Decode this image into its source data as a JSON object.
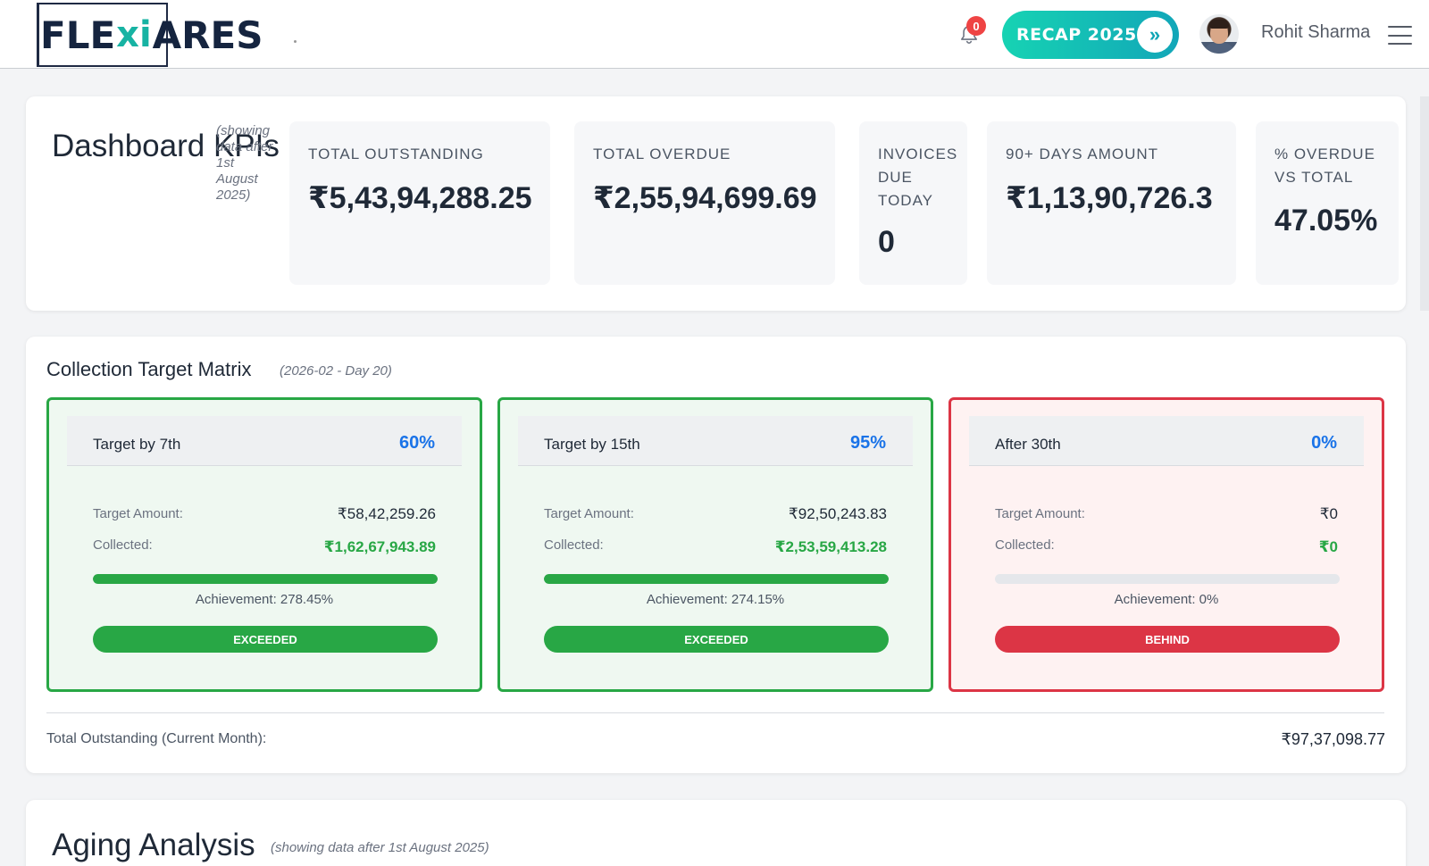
{
  "header": {
    "logo_left": "FLE",
    "logo_x": "xi",
    "logo_right": "ARES",
    "notification_count": "0",
    "recap_label": "RECAP 2025",
    "recap_arrow": "»",
    "user_name": "Rohit Sharma"
  },
  "kpis": {
    "title": "Dashboard KPIs",
    "note": "(showing data after 1st August 2025)",
    "cards": [
      {
        "label": "TOTAL OUTSTANDING",
        "value": "₹5,43,94,288.25"
      },
      {
        "label": "TOTAL OVERDUE",
        "value": "₹2,55,94,699.69"
      },
      {
        "label": "INVOICES DUE TODAY",
        "value": "0"
      },
      {
        "label": "90+ DAYS AMOUNT",
        "value": "₹1,13,90,726.3"
      },
      {
        "label": "% OVERDUE VS TOTAL",
        "value": "47.05%"
      }
    ]
  },
  "collection_matrix": {
    "title": "Collection Target Matrix",
    "subtitle": "(2026-02 - Day 20)",
    "target_amount_label": "Target Amount:",
    "collected_label": "Collected:",
    "targets": [
      {
        "name": "Target by 7th",
        "percent": "60%",
        "target_amount": "₹58,42,259.26",
        "collected": "₹1,62,67,943.89",
        "achievement": "Achievement: 278.45%",
        "progress": 1.0,
        "status": "EXCEEDED"
      },
      {
        "name": "Target by 15th",
        "percent": "95%",
        "target_amount": "₹92,50,243.83",
        "collected": "₹2,53,59,413.28",
        "achievement": "Achievement: 274.15%",
        "progress": 1.0,
        "status": "EXCEEDED"
      },
      {
        "name": "After 30th",
        "percent": "0%",
        "target_amount": "₹0",
        "collected": "₹0",
        "achievement": "Achievement: 0%",
        "progress": 0.0,
        "status": "BEHIND"
      }
    ],
    "total_label": "Total Outstanding (Current Month):",
    "total_value": "₹97,37,098.77"
  },
  "aging": {
    "title": "Aging Analysis",
    "subtitle": "(showing data after 1st August 2025)"
  },
  "colors": {
    "success": "#28a745",
    "danger": "#dc3545",
    "accent": "#1a73e8",
    "recap_gradient_start": "#16d3b3",
    "recap_gradient_end": "#12a6b8"
  },
  "icons": [
    "bell-icon",
    "double-chevron-right-icon",
    "hamburger-menu-icon"
  ]
}
